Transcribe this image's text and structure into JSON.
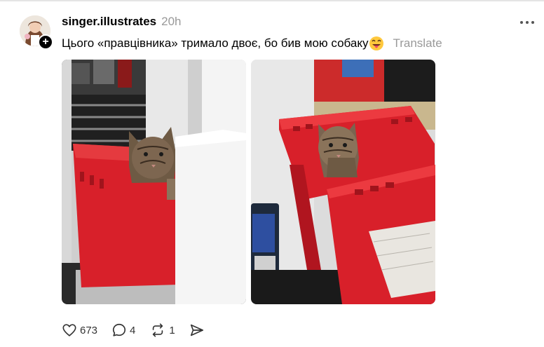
{
  "post": {
    "username": "singer.illustrates",
    "time": "20h",
    "caption": "Цього «правцівника» тримало двоє, бо бив мою собаку",
    "translate": "Translate",
    "follow_symbol": "+",
    "icons": {
      "more": "more-horizontal-icon",
      "emoji": "face-with-tongue-emoji",
      "like": "heart-icon",
      "reply": "speech-bubble-icon",
      "repost": "repost-icon",
      "share": "send-icon"
    }
  },
  "actions": {
    "likes": "673",
    "replies": "4",
    "reposts": "1"
  },
  "colors": {
    "crate_red": "#d8202a",
    "muted_text": "#999999"
  }
}
